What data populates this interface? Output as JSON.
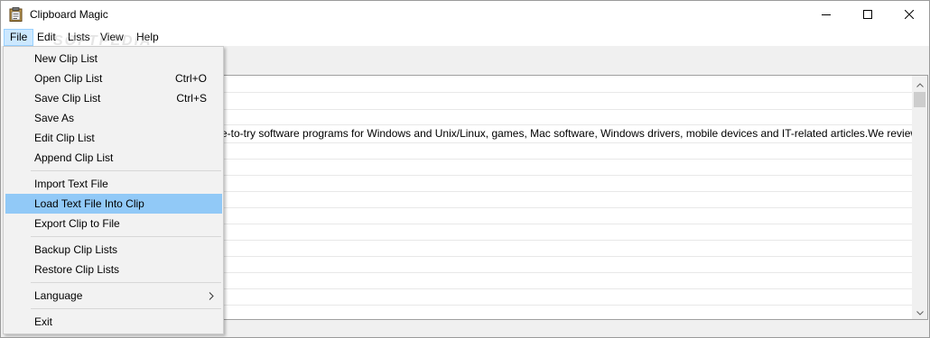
{
  "window": {
    "title": "Clipboard Magic",
    "controls": {
      "minimize_icon": "minimize-icon",
      "maximize_icon": "maximize-icon",
      "close_icon": "close-icon"
    }
  },
  "menubar": {
    "items": [
      {
        "label": "File",
        "active": true
      },
      {
        "label": "Edit"
      },
      {
        "label": "Lists"
      },
      {
        "label": "View"
      },
      {
        "label": "Help"
      }
    ]
  },
  "watermark": "SOFTPEDIA",
  "file_menu": {
    "items": [
      {
        "label": "New Clip List",
        "shortcut": ""
      },
      {
        "label": "Open Clip List",
        "shortcut": "Ctrl+O"
      },
      {
        "label": "Save Clip List",
        "shortcut": "Ctrl+S"
      },
      {
        "label": "Save As",
        "shortcut": ""
      },
      {
        "label": "Edit Clip List",
        "shortcut": ""
      },
      {
        "label": "Append Clip List",
        "shortcut": ""
      },
      {
        "label": "Import Text File",
        "shortcut": ""
      },
      {
        "label": "Load Text File Into Clip",
        "shortcut": "",
        "highlighted": true
      },
      {
        "label": "Export Clip to File",
        "shortcut": ""
      },
      {
        "label": "Backup Clip Lists",
        "shortcut": ""
      },
      {
        "label": "Restore Clip Lists",
        "shortcut": ""
      },
      {
        "label": "Language",
        "submenu": true
      },
      {
        "label": "Exit",
        "shortcut": ""
      }
    ]
  },
  "clip_list": {
    "visible_text": "e-to-try software programs for Windows and Unix/Linux, games, Mac software, Windows drivers, mobile devices and IT-related articles.We review and catego"
  },
  "colors": {
    "menu_highlight": "#91c9f7",
    "menu_active": "#cce8ff",
    "app_icon": "#c8a050"
  }
}
